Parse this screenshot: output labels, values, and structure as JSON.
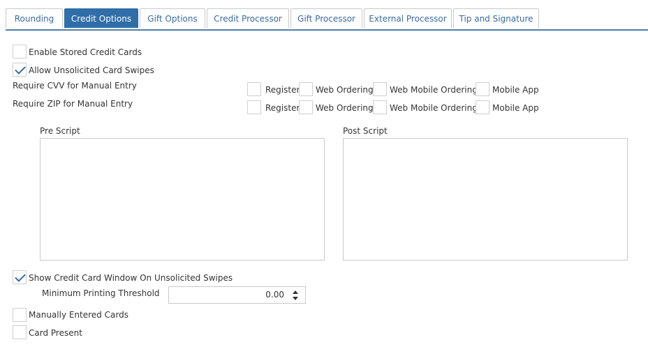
{
  "tabs": [
    {
      "label": "Rounding",
      "active": false
    },
    {
      "label": "Credit Options",
      "active": true
    },
    {
      "label": "Gift Options",
      "active": false
    },
    {
      "label": "Credit Processor",
      "active": false
    },
    {
      "label": "Gift Processor",
      "active": false
    },
    {
      "label": "External Processor",
      "active": false
    },
    {
      "label": "Tip and Signature",
      "active": false
    }
  ],
  "options": {
    "enable_stored": {
      "label": "Enable Stored Credit Cards",
      "checked": false
    },
    "allow_unsolicited": {
      "label": "Allow Unsolicited Card Swipes",
      "checked": true
    }
  },
  "require_cvv": {
    "label": "Require CVV for Manual Entry",
    "channels": [
      {
        "label": "Register",
        "checked": false
      },
      {
        "label": "Web Ordering",
        "checked": false
      },
      {
        "label": "Web Mobile Ordering",
        "checked": false
      },
      {
        "label": "Mobile App",
        "checked": false
      }
    ]
  },
  "require_zip": {
    "label": "Require ZIP for Manual Entry",
    "channels": [
      {
        "label": "Register",
        "checked": false
      },
      {
        "label": "Web Ordering",
        "checked": false
      },
      {
        "label": "Web Mobile Ordering",
        "checked": false
      },
      {
        "label": "Mobile App",
        "checked": false
      }
    ]
  },
  "pre_script": {
    "label": "Pre Script",
    "value": ""
  },
  "post_script": {
    "label": "Post Script",
    "value": ""
  },
  "show_window": {
    "label": "Show Credit Card Window On Unsolicited Swipes",
    "checked": true
  },
  "min_threshold": {
    "label": "Minimum Printing Threshold",
    "value": "0.00"
  },
  "manually_entered": {
    "label": "Manually Entered Cards",
    "checked": false
  },
  "card_present": {
    "label": "Card Present",
    "checked": false
  },
  "colors": {
    "accent": "#2f6ea8",
    "tab_text": "#3a6aa0",
    "border": "#c9c9c9"
  }
}
